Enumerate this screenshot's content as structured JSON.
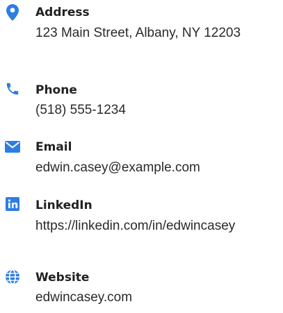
{
  "contacts": {
    "accent_color": "#2e7de1",
    "items": [
      {
        "icon": "map-pin-icon",
        "label": "Address",
        "value": "123 Main Street, Albany, NY 12203"
      },
      {
        "icon": "phone-icon",
        "label": "Phone",
        "value": "(518) 555-1234"
      },
      {
        "icon": "envelope-icon",
        "label": "Email",
        "value": "edwin.casey@example.com"
      },
      {
        "icon": "linkedin-icon",
        "label": "LinkedIn",
        "value": "https://linkedin.com/in/edwincasey"
      },
      {
        "icon": "globe-icon",
        "label": "Website",
        "value": "edwincasey.com"
      }
    ]
  }
}
